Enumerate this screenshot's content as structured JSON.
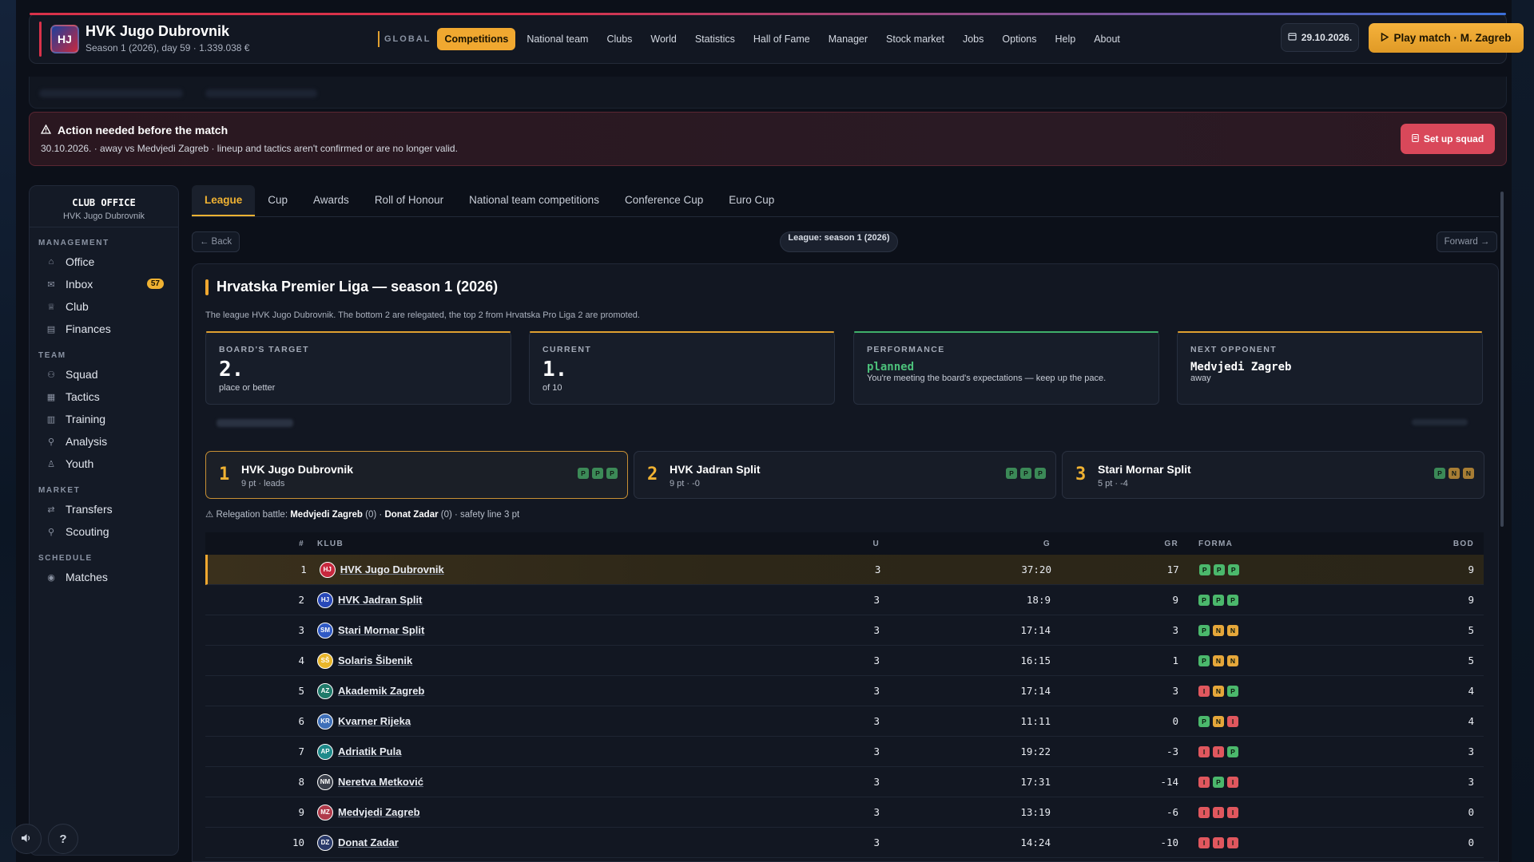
{
  "header": {
    "badge": "HJ",
    "club_name": "HVK Jugo Dubrovnik",
    "club_sub": "Season 1 (2026), day 59 · 1.339.038 €",
    "global_label": "GLOBAL",
    "nav": [
      "Competitions",
      "National team",
      "Clubs",
      "World",
      "Statistics",
      "Hall of Fame",
      "Manager",
      "Stock market",
      "Jobs",
      "Options",
      "Help",
      "About"
    ],
    "date": "29.10.2026.",
    "play_label": "Play match · M. Zagreb"
  },
  "alert": {
    "title": "Action needed before the match",
    "text": "30.10.2026. · away vs Medvjedi Zagreb · lineup and tactics aren't confirmed or are no longer valid.",
    "button": "Set up squad"
  },
  "sidebar": {
    "title": "CLUB OFFICE",
    "subtitle": "HVK Jugo Dubrovnik",
    "sections": {
      "management": "MANAGEMENT",
      "team": "TEAM",
      "market": "MARKET",
      "schedule": "SCHEDULE"
    },
    "items": {
      "office": "Office",
      "inbox": "Inbox",
      "inbox_count": "57",
      "club": "Club",
      "finances": "Finances",
      "squad": "Squad",
      "tactics": "Tactics",
      "training": "Training",
      "analysis": "Analysis",
      "youth": "Youth",
      "transfers": "Transfers",
      "scouting": "Scouting",
      "matches": "Matches"
    },
    "help": "?"
  },
  "tabs": [
    "League",
    "Cup",
    "Awards",
    "Roll of Honour",
    "National team competitions",
    "Conference Cup",
    "Euro Cup"
  ],
  "subnav": {
    "back": "← Back",
    "season": "League: season 1 (2026)",
    "forward": "Forward →"
  },
  "league": {
    "title": "Hrvatska Premier Liga — season 1 (2026)",
    "description": "The league HVK Jugo Dubrovnik. The bottom 2 are relegated, the top 2 from Hrvatska Pro Liga 2 are promoted.",
    "cards": {
      "target_label": "BOARD'S TARGET",
      "target_value": "2.",
      "target_sub": "place or better",
      "current_label": "CURRENT",
      "current_value": "1.",
      "current_sub": "of 10",
      "perf_label": "PERFORMANCE",
      "perf_value": "planned",
      "perf_sub": "You're meeting the board's expectations — keep up the pace.",
      "next_label": "NEXT OPPONENT",
      "next_value": "Medvjedi Zagreb",
      "next_sub": "away"
    },
    "leaders": [
      {
        "rank": "1",
        "name": "HVK Jugo Dubrovnik",
        "pts": "9 pt · leads",
        "form": [
          "P",
          "P",
          "P"
        ]
      },
      {
        "rank": "2",
        "name": "HVK Jadran Split",
        "pts": "9 pt · -0",
        "form": [
          "P",
          "P",
          "P"
        ]
      },
      {
        "rank": "3",
        "name": "Stari Mornar Split",
        "pts": "5 pt · -4",
        "form": [
          "P",
          "N",
          "N"
        ]
      }
    ],
    "relegation": {
      "prefix": "⚠ Relegation battle:",
      "team1": "Medvjedi Zagreb",
      "team1_pts": "(0) ·",
      "team2": "Donat Zadar",
      "team2_pts": "(0) · safety line 3 pt"
    },
    "columns": {
      "rank": "#",
      "club": "KLUB",
      "u": "U",
      "g": "G",
      "gr": "GR",
      "form": "FORMA",
      "bod": "BOD"
    },
    "rows": [
      {
        "rank": "1",
        "crest": "HJ",
        "crest_color": "#c8283e",
        "club": "HVK Jugo Dubrovnik",
        "u": "3",
        "g": "37:20",
        "gr": "17",
        "form": [
          "P",
          "P",
          "P"
        ],
        "bod": "9",
        "me": true
      },
      {
        "rank": "2",
        "crest": "HJ",
        "crest_color": "#2848b8",
        "club": "HVK Jadran Split",
        "u": "3",
        "g": "18:9",
        "gr": "9",
        "form": [
          "P",
          "P",
          "P"
        ],
        "bod": "9"
      },
      {
        "rank": "3",
        "crest": "SM",
        "crest_color": "#2f59c4",
        "club": "Stari Mornar Split",
        "u": "3",
        "g": "17:14",
        "gr": "3",
        "form": [
          "P",
          "N",
          "N"
        ],
        "bod": "5"
      },
      {
        "rank": "4",
        "crest": "SŠ",
        "crest_color": "#e8b52a",
        "club": "Solaris Šibenik",
        "u": "3",
        "g": "16:15",
        "gr": "1",
        "form": [
          "P",
          "N",
          "N"
        ],
        "bod": "5"
      },
      {
        "rank": "5",
        "crest": "AZ",
        "crest_color": "#1f7a6a",
        "club": "Akademik Zagreb",
        "u": "3",
        "g": "17:14",
        "gr": "3",
        "form": [
          "I",
          "N",
          "P"
        ],
        "bod": "4"
      },
      {
        "rank": "6",
        "crest": "KR",
        "crest_color": "#3e6fb8",
        "club": "Kvarner Rijeka",
        "u": "3",
        "g": "11:11",
        "gr": "0",
        "form": [
          "P",
          "N",
          "I"
        ],
        "bod": "4"
      },
      {
        "rank": "7",
        "crest": "AP",
        "crest_color": "#1e8a8a",
        "club": "Adriatik Pula",
        "u": "3",
        "g": "19:22",
        "gr": "-3",
        "form": [
          "I",
          "I",
          "P"
        ],
        "bod": "3"
      },
      {
        "rank": "8",
        "crest": "NM",
        "crest_color": "#3a3f4a",
        "club": "Neretva Metković",
        "u": "3",
        "g": "17:31",
        "gr": "-14",
        "form": [
          "I",
          "P",
          "I"
        ],
        "bod": "3"
      },
      {
        "rank": "9",
        "crest": "MZ",
        "crest_color": "#b03a4a",
        "club": "Medvjedi Zagreb",
        "u": "3",
        "g": "13:19",
        "gr": "-6",
        "form": [
          "I",
          "I",
          "I"
        ],
        "bod": "0"
      },
      {
        "rank": "10",
        "crest": "DZ",
        "crest_color": "#2a3a6a",
        "club": "Donat Zadar",
        "u": "3",
        "g": "14:24",
        "gr": "-10",
        "form": [
          "I",
          "I",
          "I"
        ],
        "bod": "0"
      }
    ]
  }
}
